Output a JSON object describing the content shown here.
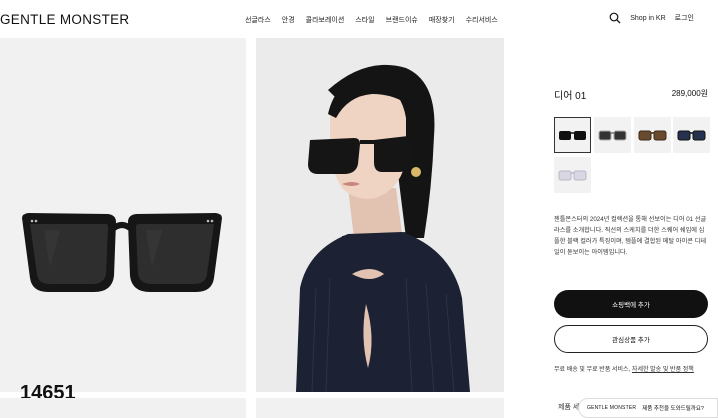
{
  "header": {
    "logo": "GENTLE MONSTER",
    "nav": [
      "선글라스",
      "안경",
      "콜라보레이션",
      "스타일",
      "브랜드이슈",
      "매장찾기",
      "수리서비스"
    ],
    "shop_in": "Shop in KR",
    "login": "로그인"
  },
  "gallery": {
    "code_label": "14651"
  },
  "product": {
    "name": "디어 01",
    "price": "289,000원",
    "description": "젠틀몬스터의 2024년 컬렉션을 통해 선보이는 디어 01 선글라스를 소개합니다. 직선의 스케치를 더한 스퀘어 쉐입에 심플한 블랙 컬러가 특징이며, 템플에 결합된 메탈 아이콘 디테일이 돋보이는 아이템입니다.",
    "cart_button": "쇼핑백에 추가",
    "wish_button": "관심상품 추가",
    "shipping_text": "무료 배송 및 무료 반품 서비스,",
    "shipping_link": "자세한 발송 및 반품 정책",
    "tab_partial": "제품 세"
  },
  "chat": {
    "brand": "GENTLE MONSTER",
    "text": "제품 추천을 도와드릴까요?"
  },
  "colors": {
    "accent": "#111111",
    "panel_bg": "#f1f1f1"
  }
}
